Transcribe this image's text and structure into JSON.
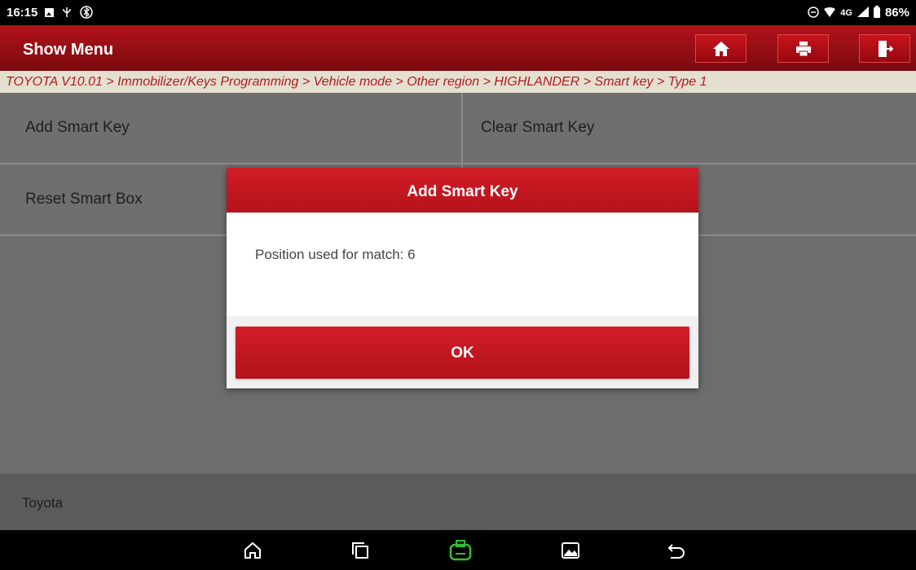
{
  "status_bar": {
    "time": "16:15",
    "network": "4G",
    "battery": "86%"
  },
  "header": {
    "title": "Show Menu",
    "buttons": [
      {
        "icon": "home-icon"
      },
      {
        "icon": "print-icon"
      },
      {
        "icon": "exit-icon"
      }
    ]
  },
  "breadcrumb": "TOYOTA V10.01 > Immobilizer/Keys Programming > Vehicle mode > Other region > HIGHLANDER > Smart key > Type 1",
  "menu": {
    "items": [
      {
        "label": "Add Smart Key"
      },
      {
        "label": "Clear Smart Key"
      },
      {
        "label": "Reset Smart Box"
      }
    ]
  },
  "footer": {
    "label": "Toyota"
  },
  "dialog": {
    "title": "Add Smart Key",
    "message": "Position used for match: 6",
    "ok_label": "OK"
  },
  "nav_bar": {
    "icons": [
      "home-icon",
      "recent-apps-icon",
      "vci-icon",
      "gallery-icon",
      "back-icon"
    ]
  },
  "colors": {
    "accent_red": "#b3121a",
    "vci_green": "#2fc12f"
  }
}
